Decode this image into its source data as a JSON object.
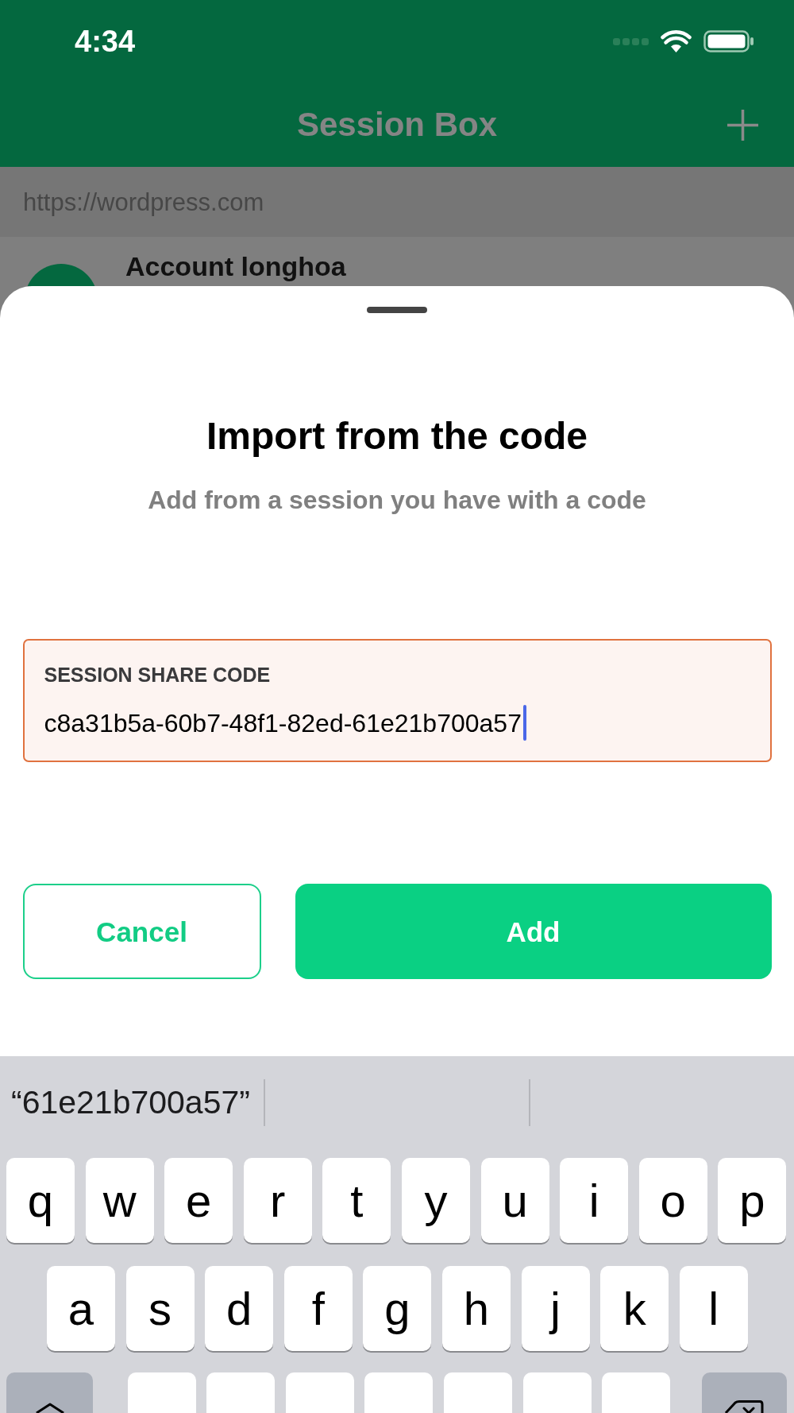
{
  "status_bar": {
    "time": "4:34"
  },
  "nav_bar": {
    "title": "Session Box"
  },
  "list": {
    "section_header": "https://wordpress.com",
    "items": [
      {
        "name": "Account longhoa"
      }
    ]
  },
  "sheet": {
    "title": "Import from the code",
    "subtitle": "Add from a session you have with a code",
    "field": {
      "label": "SESSION SHARE CODE",
      "value": "c8a31b5a-60b7-48f1-82ed-61e21b700a57",
      "focused": true
    },
    "buttons": [
      {
        "label": "Cancel",
        "kind": "outline"
      },
      {
        "label": "Add",
        "kind": "primary"
      }
    ]
  },
  "keyboard": {
    "suggestions": [
      "“61e21b700a57”"
    ],
    "rows": [
      [
        "q",
        "w",
        "e",
        "r",
        "t",
        "y",
        "u",
        "i",
        "o",
        "p"
      ],
      [
        "a",
        "s",
        "d",
        "f",
        "g",
        "h",
        "j",
        "k",
        "l"
      ]
    ]
  }
}
